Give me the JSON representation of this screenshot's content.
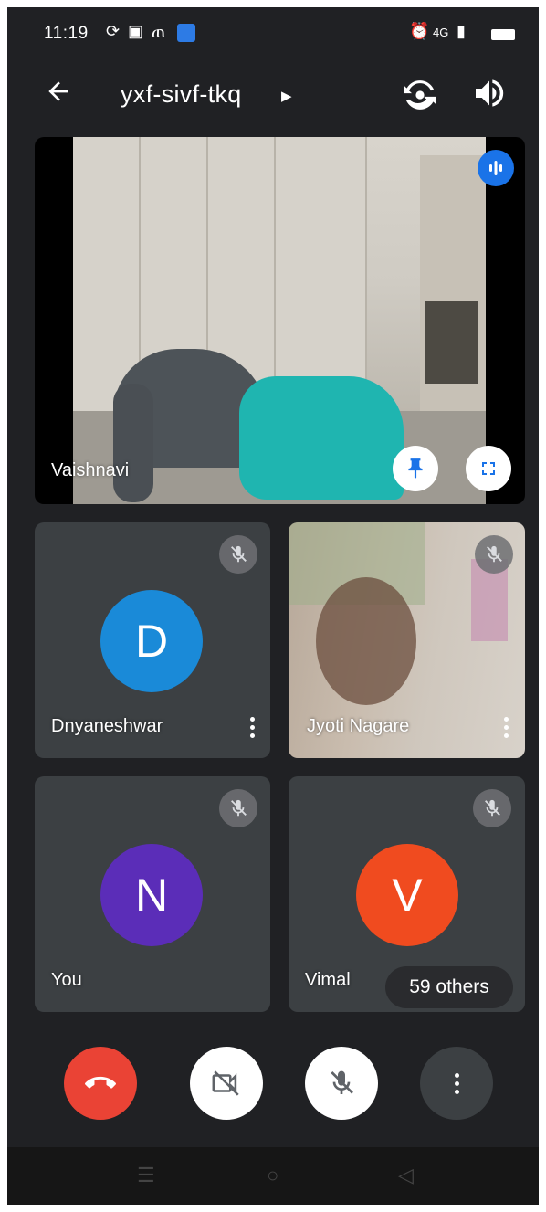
{
  "status_bar": {
    "time": "11:19",
    "signal_text": "4G"
  },
  "header": {
    "meeting_code": "yxf-sivf-tkq"
  },
  "main_tile": {
    "name": "Vaishnavi"
  },
  "tiles": [
    {
      "name": "Dnyaneshwar",
      "initial": "D",
      "color": "#1a8ad8"
    },
    {
      "name": "Jyoti Nagare"
    },
    {
      "name": "You",
      "initial": "N",
      "color": "#5b2db8"
    },
    {
      "name": "Vimal",
      "initial": "V",
      "color": "#f04b1f"
    }
  ],
  "others_badge": "59 others",
  "colors": {
    "background": "#202124",
    "tile": "#3c4043",
    "end_call": "#ea4335",
    "speaking": "#1a73e8"
  }
}
